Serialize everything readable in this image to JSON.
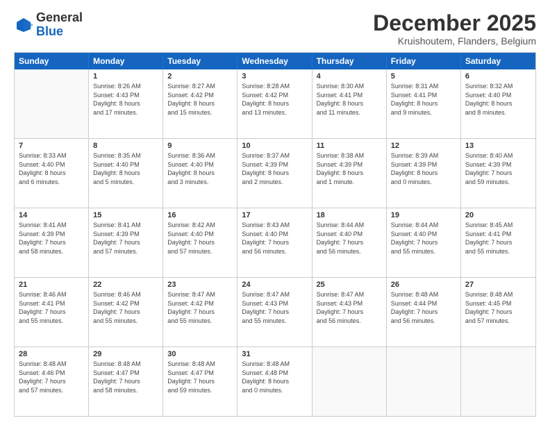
{
  "header": {
    "logo_general": "General",
    "logo_blue": "Blue",
    "title": "December 2025",
    "subtitle": "Kruishoutem, Flanders, Belgium"
  },
  "days_of_week": [
    "Sunday",
    "Monday",
    "Tuesday",
    "Wednesday",
    "Thursday",
    "Friday",
    "Saturday"
  ],
  "weeks": [
    [
      {
        "day": "",
        "info": ""
      },
      {
        "day": "1",
        "info": "Sunrise: 8:26 AM\nSunset: 4:43 PM\nDaylight: 8 hours\nand 17 minutes."
      },
      {
        "day": "2",
        "info": "Sunrise: 8:27 AM\nSunset: 4:42 PM\nDaylight: 8 hours\nand 15 minutes."
      },
      {
        "day": "3",
        "info": "Sunrise: 8:28 AM\nSunset: 4:42 PM\nDaylight: 8 hours\nand 13 minutes."
      },
      {
        "day": "4",
        "info": "Sunrise: 8:30 AM\nSunset: 4:41 PM\nDaylight: 8 hours\nand 11 minutes."
      },
      {
        "day": "5",
        "info": "Sunrise: 8:31 AM\nSunset: 4:41 PM\nDaylight: 8 hours\nand 9 minutes."
      },
      {
        "day": "6",
        "info": "Sunrise: 8:32 AM\nSunset: 4:40 PM\nDaylight: 8 hours\nand 8 minutes."
      }
    ],
    [
      {
        "day": "7",
        "info": "Sunrise: 8:33 AM\nSunset: 4:40 PM\nDaylight: 8 hours\nand 6 minutes."
      },
      {
        "day": "8",
        "info": "Sunrise: 8:35 AM\nSunset: 4:40 PM\nDaylight: 8 hours\nand 5 minutes."
      },
      {
        "day": "9",
        "info": "Sunrise: 8:36 AM\nSunset: 4:40 PM\nDaylight: 8 hours\nand 3 minutes."
      },
      {
        "day": "10",
        "info": "Sunrise: 8:37 AM\nSunset: 4:39 PM\nDaylight: 8 hours\nand 2 minutes."
      },
      {
        "day": "11",
        "info": "Sunrise: 8:38 AM\nSunset: 4:39 PM\nDaylight: 8 hours\nand 1 minute."
      },
      {
        "day": "12",
        "info": "Sunrise: 8:39 AM\nSunset: 4:39 PM\nDaylight: 8 hours\nand 0 minutes."
      },
      {
        "day": "13",
        "info": "Sunrise: 8:40 AM\nSunset: 4:39 PM\nDaylight: 7 hours\nand 59 minutes."
      }
    ],
    [
      {
        "day": "14",
        "info": "Sunrise: 8:41 AM\nSunset: 4:39 PM\nDaylight: 7 hours\nand 58 minutes."
      },
      {
        "day": "15",
        "info": "Sunrise: 8:41 AM\nSunset: 4:39 PM\nDaylight: 7 hours\nand 57 minutes."
      },
      {
        "day": "16",
        "info": "Sunrise: 8:42 AM\nSunset: 4:40 PM\nDaylight: 7 hours\nand 57 minutes."
      },
      {
        "day": "17",
        "info": "Sunrise: 8:43 AM\nSunset: 4:40 PM\nDaylight: 7 hours\nand 56 minutes."
      },
      {
        "day": "18",
        "info": "Sunrise: 8:44 AM\nSunset: 4:40 PM\nDaylight: 7 hours\nand 56 minutes."
      },
      {
        "day": "19",
        "info": "Sunrise: 8:44 AM\nSunset: 4:40 PM\nDaylight: 7 hours\nand 55 minutes."
      },
      {
        "day": "20",
        "info": "Sunrise: 8:45 AM\nSunset: 4:41 PM\nDaylight: 7 hours\nand 55 minutes."
      }
    ],
    [
      {
        "day": "21",
        "info": "Sunrise: 8:46 AM\nSunset: 4:41 PM\nDaylight: 7 hours\nand 55 minutes."
      },
      {
        "day": "22",
        "info": "Sunrise: 8:46 AM\nSunset: 4:42 PM\nDaylight: 7 hours\nand 55 minutes."
      },
      {
        "day": "23",
        "info": "Sunrise: 8:47 AM\nSunset: 4:42 PM\nDaylight: 7 hours\nand 55 minutes."
      },
      {
        "day": "24",
        "info": "Sunrise: 8:47 AM\nSunset: 4:43 PM\nDaylight: 7 hours\nand 55 minutes."
      },
      {
        "day": "25",
        "info": "Sunrise: 8:47 AM\nSunset: 4:43 PM\nDaylight: 7 hours\nand 56 minutes."
      },
      {
        "day": "26",
        "info": "Sunrise: 8:48 AM\nSunset: 4:44 PM\nDaylight: 7 hours\nand 56 minutes."
      },
      {
        "day": "27",
        "info": "Sunrise: 8:48 AM\nSunset: 4:45 PM\nDaylight: 7 hours\nand 57 minutes."
      }
    ],
    [
      {
        "day": "28",
        "info": "Sunrise: 8:48 AM\nSunset: 4:46 PM\nDaylight: 7 hours\nand 57 minutes."
      },
      {
        "day": "29",
        "info": "Sunrise: 8:48 AM\nSunset: 4:47 PM\nDaylight: 7 hours\nand 58 minutes."
      },
      {
        "day": "30",
        "info": "Sunrise: 8:48 AM\nSunset: 4:47 PM\nDaylight: 7 hours\nand 59 minutes."
      },
      {
        "day": "31",
        "info": "Sunrise: 8:48 AM\nSunset: 4:48 PM\nDaylight: 8 hours\nand 0 minutes."
      },
      {
        "day": "",
        "info": ""
      },
      {
        "day": "",
        "info": ""
      },
      {
        "day": "",
        "info": ""
      }
    ]
  ]
}
